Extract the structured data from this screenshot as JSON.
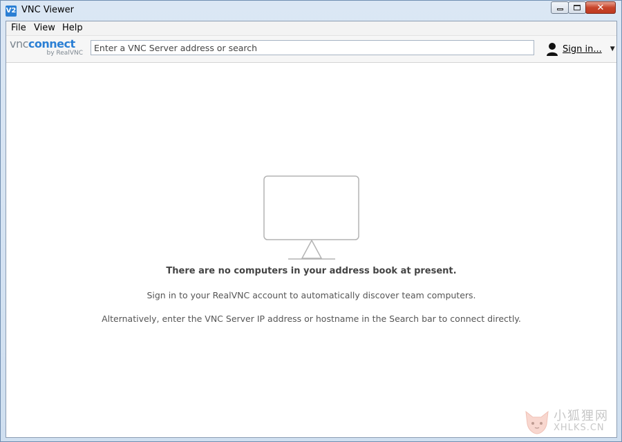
{
  "window": {
    "title": "VNC Viewer",
    "icon": "vnc-viewer-icon",
    "icon_text": "V2"
  },
  "menu": {
    "items": [
      {
        "label": "File"
      },
      {
        "label": "View"
      },
      {
        "label": "Help"
      }
    ]
  },
  "toolbar": {
    "logo": {
      "brand_vnc": "vnc",
      "brand_connect": "connect",
      "byline": "by RealVNC"
    },
    "search": {
      "value": "",
      "placeholder": "Enter a VNC Server address or search"
    },
    "signin": {
      "label": "Sign in...",
      "icon": "user-icon",
      "caret": "▼"
    }
  },
  "empty_state": {
    "icon": "monitor-icon",
    "heading": "There are no computers in your address book at present.",
    "line1": "Sign in to your RealVNC account to automatically discover team computers.",
    "line2": "Alternatively, enter the VNC Server IP address or hostname in the Search bar to connect directly."
  },
  "watermark": {
    "cn": "小狐狸网",
    "en": "XHLKS.CN"
  },
  "colors": {
    "accent": "#2b7fd4",
    "titlebar": "#dbe7f4",
    "close_button": "#c7452b",
    "text_muted": "#555555"
  }
}
